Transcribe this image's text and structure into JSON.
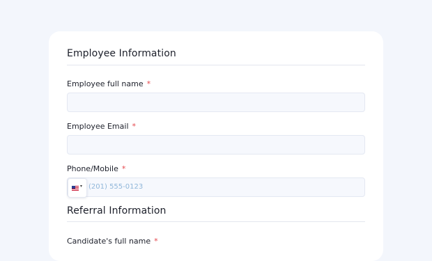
{
  "employee_section": {
    "title": "Employee Information",
    "full_name_label": "Employee full name",
    "email_label": "Employee Email",
    "phone_label": "Phone/Mobile",
    "required_mark": "*",
    "phone_placeholder": "(201) 555-0123",
    "country_flag_icon": "us-flag-icon",
    "caret": "▾"
  },
  "referral_section": {
    "title": "Referral Information",
    "candidate_name_label": "Candidate's full name"
  }
}
